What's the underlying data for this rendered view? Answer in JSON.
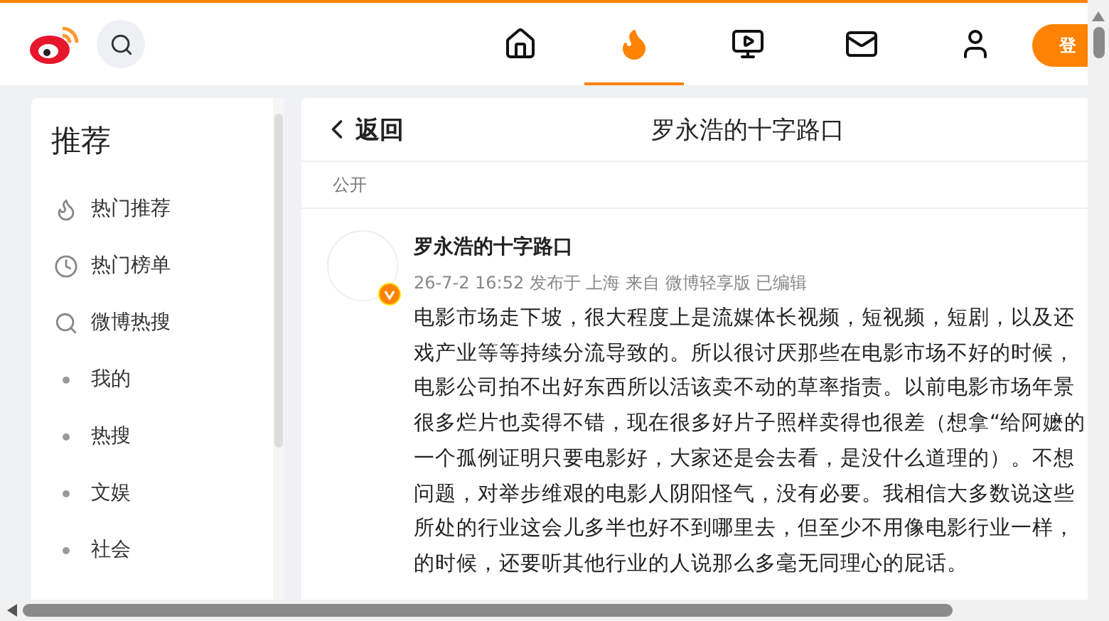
{
  "header": {
    "nav": [
      {
        "kind": "home",
        "selected": false
      },
      {
        "kind": "hot",
        "selected": true
      },
      {
        "kind": "video",
        "selected": false
      },
      {
        "kind": "mail",
        "selected": false
      },
      {
        "kind": "profile",
        "selected": false
      }
    ],
    "login": "登"
  },
  "sidebar": {
    "title": "推荐",
    "items": [
      {
        "kind": "hot",
        "label": "热门推荐"
      },
      {
        "kind": "rank",
        "label": "热门榜单"
      },
      {
        "kind": "search",
        "label": "微博热搜"
      },
      {
        "kind": "bullet",
        "label": "我的"
      },
      {
        "kind": "bullet",
        "label": "热搜"
      },
      {
        "kind": "bullet",
        "label": "文娱"
      },
      {
        "kind": "bullet",
        "label": "社会"
      }
    ]
  },
  "main": {
    "back": "返回",
    "title": "罗永浩的十字路口",
    "visibility": "公开",
    "post": {
      "author": "罗永浩的十字路口",
      "verified": true,
      "meta": "26-7-2 16:52 发布于 上海 来自 微博轻享版 已编辑",
      "lines": [
        "电影市场走下坡，很大程度上是流媒体长视频，短视频，短剧，以及还",
        "戏产业等等持续分流导致的。所以很讨厌那些在电影市场不好的时候，",
        "电影公司拍不出好东西所以活该卖不动的草率指责。以前电影市场年景",
        "很多烂片也卖得不错，现在很多好片子照样卖得也很差（想拿“给阿嬷的",
        "一个孤例证明只要电影好，大家还是会去看，是没什么道理的）。不想",
        "问题，对举步维艰的电影人阴阳怪气，没有必要。我相信大多数说这些",
        "所处的行业这会儿多半也好不到哪里去，但至少不用像电影行业一样，",
        "的时候，还要听其他行业的人说那么多毫无同理心的屁话。"
      ]
    }
  }
}
